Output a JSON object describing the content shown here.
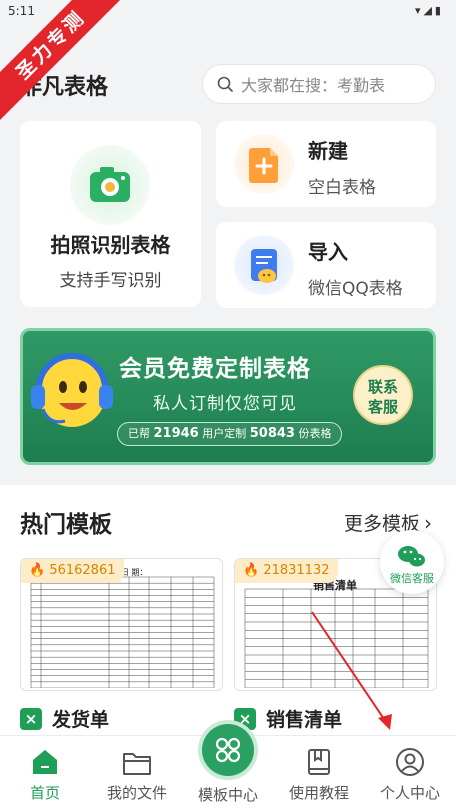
{
  "status_bar": {
    "time": "5:11",
    "icons": "▾◢▮"
  },
  "watermark": {
    "text": "圣力专测"
  },
  "header": {
    "app_title": "非凡表格",
    "search_placeholder": "大家都在搜：考勤表"
  },
  "cards": {
    "photo": {
      "title": "拍照识别表格",
      "subtitle": "支持手写识别"
    },
    "new": {
      "title": "新建",
      "subtitle": "空白表格"
    },
    "import": {
      "title": "导入",
      "subtitle": "微信QQ表格"
    }
  },
  "banner": {
    "title": "会员免费定制表格",
    "subtitle": "私人订制仅您可见",
    "stat_prefix": "已帮",
    "users": "21946",
    "stat_mid": "用户定制",
    "tables": "50843",
    "stat_suffix": "份表格",
    "contact_line1": "联系",
    "contact_line2": "客服"
  },
  "templates": {
    "section_title": "热门模板",
    "more_label": "更多模板",
    "items": [
      {
        "heat": "56162861",
        "name": "发货单",
        "sheet_title": "日 期："
      },
      {
        "heat": "21831132",
        "name": "销售清单",
        "sheet_title": "销售清单"
      }
    ]
  },
  "float_service": {
    "label": "微信客服"
  },
  "bottom_nav": {
    "items": [
      {
        "label": "首页"
      },
      {
        "label": "我的文件"
      },
      {
        "label": "模板中心"
      },
      {
        "label": "使用教程"
      },
      {
        "label": "个人中心"
      }
    ]
  },
  "colors": {
    "brand_green": "#1e9e57",
    "banner_green": "#2f9a66",
    "watermark_red": "#e3262b",
    "heat_orange": "#d98400"
  }
}
